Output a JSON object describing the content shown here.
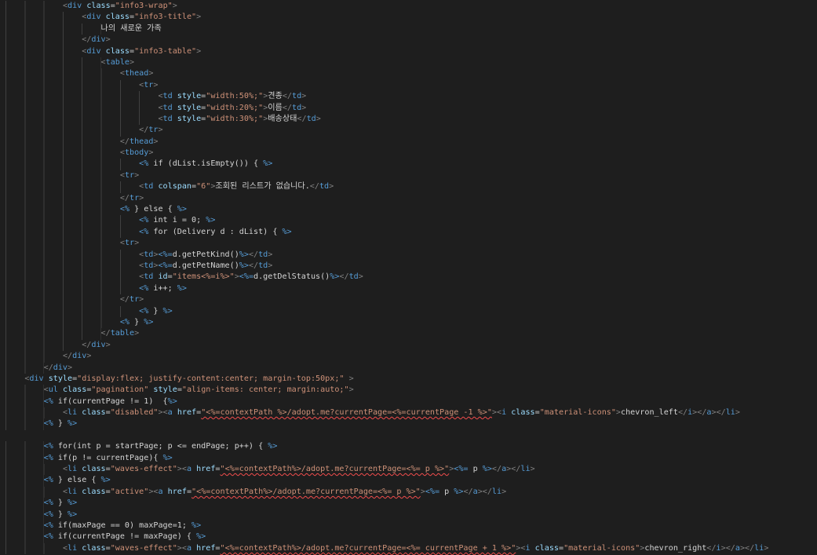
{
  "editor": {
    "theme": {
      "background": "#1e1e1e",
      "indent_guide": "#404040",
      "tag_bracket": "#808080",
      "tag_name": "#569cd6",
      "attr_name": "#9cdcfe",
      "attr_value": "#ce9178",
      "text": "#d4d4d4",
      "jsp_delimiter": "#569cd6",
      "java_code": "#d4d4d4",
      "error_squiggle": "#f14c4c"
    },
    "lines": [
      {
        "text": "            <div class=\"info3-wrap\">"
      },
      {
        "text": "                <div class=\"info3-title\">"
      },
      {
        "text": "                    나의 새로운 가족"
      },
      {
        "text": "                </div>"
      },
      {
        "text": "                <div class=\"info3-table\">"
      },
      {
        "text": "                    <table>"
      },
      {
        "text": "                        <thead>"
      },
      {
        "text": "                            <tr>"
      },
      {
        "text": "                                <td style=\"width:50%;\">견종</td>"
      },
      {
        "text": "                                <td style=\"width:20%;\">이름</td>"
      },
      {
        "text": "                                <td style=\"width:30%;\">배송상태</td>"
      },
      {
        "text": "                            </tr>"
      },
      {
        "text": "                        </thead>"
      },
      {
        "text": "                        <tbody>"
      },
      {
        "text": "                            <% if (dList.isEmpty()) { %>"
      },
      {
        "text": "                        <tr>"
      },
      {
        "text": "                            <td colspan=\"6\">조회된 리스트가 없습니다.</td>"
      },
      {
        "text": "                        </tr>"
      },
      {
        "text": "                        <% } else { %>"
      },
      {
        "text": "                            <% int i = 0; %>"
      },
      {
        "text": "                            <% for (Delivery d : dList) { %>"
      },
      {
        "text": "                        <tr>"
      },
      {
        "text": "                            <td><%=d.getPetKind()%></td>"
      },
      {
        "text": "                            <td><%=d.getPetName()%></td>"
      },
      {
        "text": "                            <td id=\"items<%=i%>\"><%=d.getDelStatus()%></td>"
      },
      {
        "text": "                            <% i++; %>"
      },
      {
        "text": "                        </tr>"
      },
      {
        "text": "                            <% } %>"
      },
      {
        "text": "                        <% } %>"
      },
      {
        "text": "                    </table>"
      },
      {
        "text": "                </div>"
      },
      {
        "text": "            </div>"
      },
      {
        "text": "        </div>"
      },
      {
        "text": "    <div style=\"display:flex; justify-content:center; margin-top:50px;\" >"
      },
      {
        "text": "        <ul class=\"pagination\" style=\"align-items: center; margin:auto;\">"
      },
      {
        "text": "        <% if(currentPage != 1)  {%>"
      },
      {
        "text": "            <li class=\"disabled\"><a href=\"<%=contextPath %>/adopt.me?currentPage=<%=currentPage -1 %>\"><i class=\"material-icons\">chevron_left</i></a></li>",
        "squiggle": true
      },
      {
        "text": "        <% } %>"
      },
      {
        "text": ""
      },
      {
        "text": "        <% for(int p = startPage; p <= endPage; p++) { %>"
      },
      {
        "text": "        <% if(p != currentPage){ %>"
      },
      {
        "text": "            <li class=\"waves-effect\"><a href=\"<%=contextPath%>/adopt.me?currentPage=<%= p %>\"><%= p %></a></li>",
        "squiggle": true
      },
      {
        "text": "        <% } else { %>"
      },
      {
        "text": "            <li class=\"active\"><a href=\"<%=contextPath%>/adopt.me?currentPage=<%= p %>\"><%= p %></a></li>",
        "squiggle": true
      },
      {
        "text": "        <% } %>"
      },
      {
        "text": "        <% } %>"
      },
      {
        "text": "        <% if(maxPage == 0) maxPage=1; %>"
      },
      {
        "text": "        <% if(currentPage != maxPage) { %>"
      },
      {
        "text": "            <li class=\"waves-effect\"><a href=\"<%=contextPath%>/adopt.me?currentPage=<%= currentPage + 1 %>\"><i class=\"material-icons\">chevron_right</i></a></li>",
        "squiggle": true
      }
    ]
  }
}
